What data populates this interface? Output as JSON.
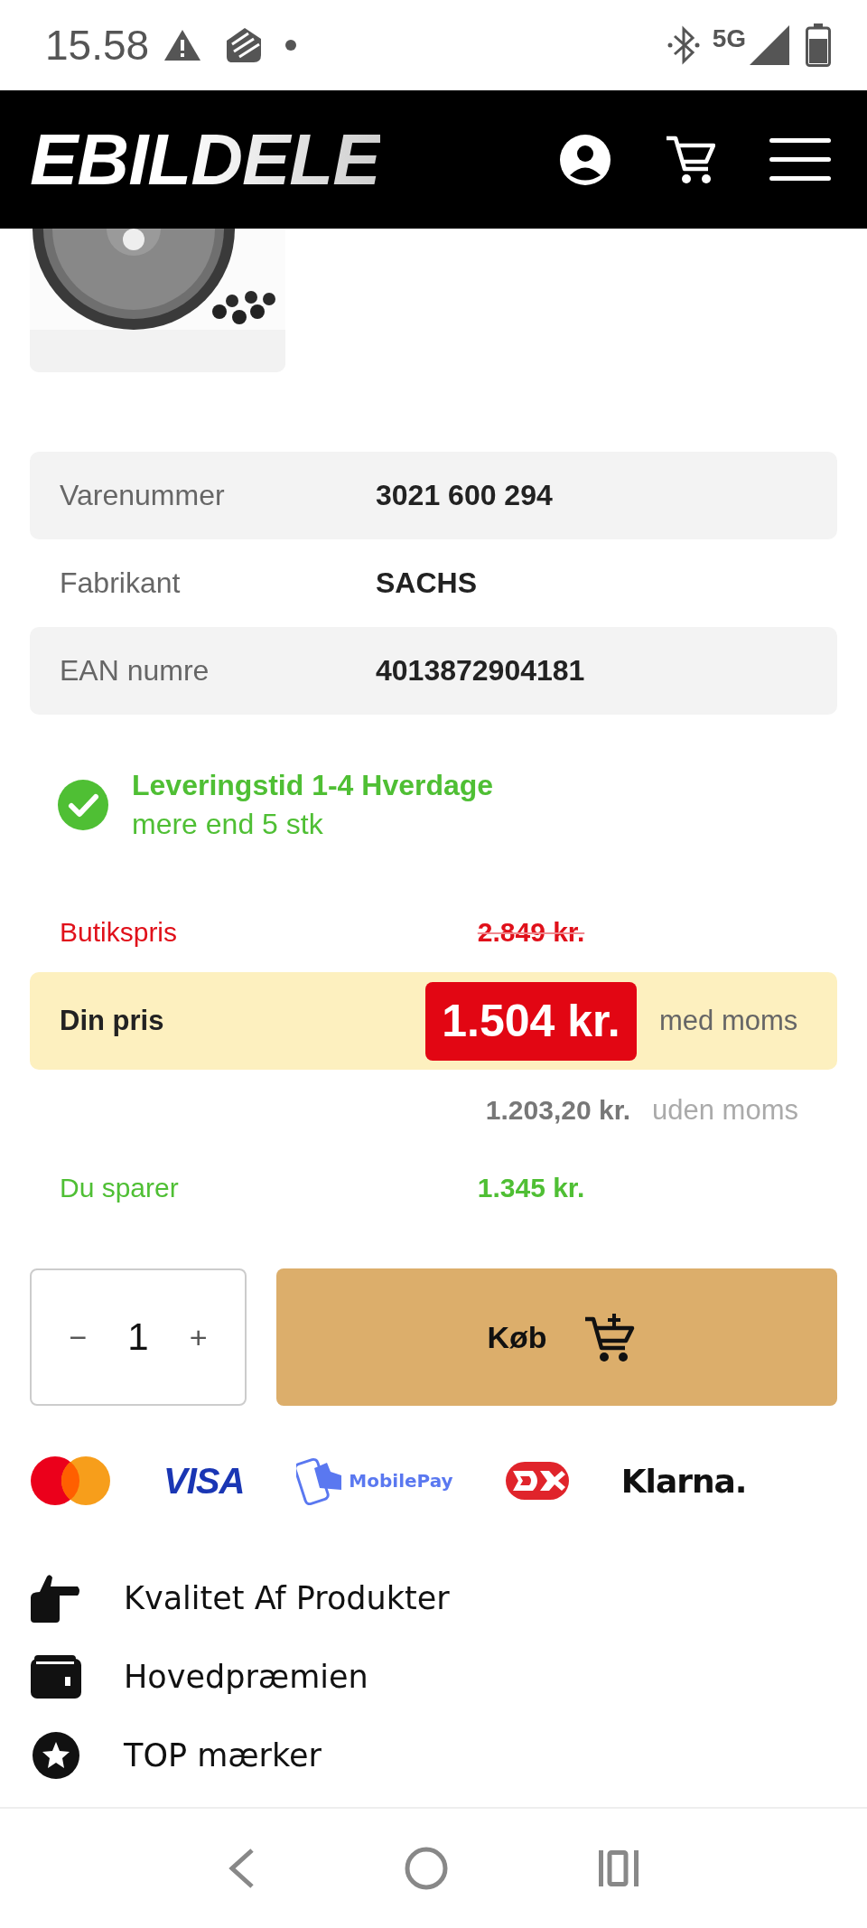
{
  "status_bar": {
    "time": "15.58",
    "network": "5G"
  },
  "header": {
    "logo": "EBILDELE"
  },
  "specs": [
    {
      "label": "Varenummer",
      "value": "3021 600 294"
    },
    {
      "label": "Fabrikant",
      "value": "SACHS"
    },
    {
      "label": "EAN numre",
      "value": "4013872904181"
    }
  ],
  "delivery": {
    "in_stock": true,
    "title": "Leveringstid 1-4 Hverdage",
    "detail": "mere end 5 stk"
  },
  "pricing": {
    "store_label": "Butikspris",
    "store_price": "2.849 kr.",
    "your_label": "Din pris",
    "your_price": "1.504 kr.",
    "vat_incl": "med moms",
    "net_price": "1.203,20 kr.",
    "vat_excl": "uden moms",
    "savings_label": "Du sparer",
    "savings": "1.345 kr."
  },
  "quantity": {
    "minus": "−",
    "value": "1",
    "plus": "+"
  },
  "buy_button": {
    "label": "Køb"
  },
  "payment_methods": [
    {
      "kind": "mastercard"
    },
    {
      "kind": "visa",
      "label": "VISA"
    },
    {
      "kind": "mobilepay",
      "label": "MobilePay"
    },
    {
      "kind": "dankort"
    },
    {
      "kind": "klarna",
      "label": "Klarna."
    }
  ],
  "features": [
    {
      "kind": "hand",
      "label": "Kvalitet Af Produkter"
    },
    {
      "kind": "wallet",
      "label": "Hovedpræmien"
    },
    {
      "kind": "star",
      "label": "TOP mærker"
    }
  ]
}
